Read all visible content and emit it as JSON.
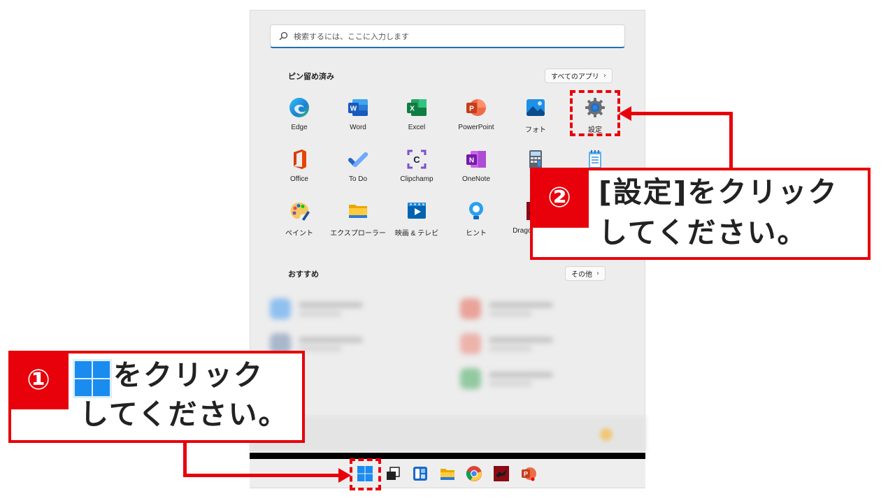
{
  "search": {
    "placeholder": "検索するには、ここに入力します"
  },
  "pinned": {
    "title": "ピン留め済み",
    "all_apps_label": "すべてのアプリ",
    "apps": [
      {
        "label": "Edge",
        "icon": "edge-icon"
      },
      {
        "label": "Word",
        "icon": "word-icon"
      },
      {
        "label": "Excel",
        "icon": "excel-icon"
      },
      {
        "label": "PowerPoint",
        "icon": "powerpoint-icon"
      },
      {
        "label": "フォト",
        "icon": "photos-icon"
      },
      {
        "label": "設定",
        "icon": "settings-gear-icon"
      },
      {
        "label": "Office",
        "icon": "office-icon"
      },
      {
        "label": "To Do",
        "icon": "todo-icon"
      },
      {
        "label": "Clipchamp",
        "icon": "clipchamp-icon"
      },
      {
        "label": "OneNote",
        "icon": "onenote-icon"
      },
      {
        "label": "",
        "icon": "calculator-icon"
      },
      {
        "label": "",
        "icon": "notepad-icon"
      },
      {
        "label": "ペイント",
        "icon": "paint-icon"
      },
      {
        "label": "エクスプローラー",
        "icon": "explorer-icon"
      },
      {
        "label": "映画 & テレビ",
        "icon": "movies-icon"
      },
      {
        "label": "ヒント",
        "icon": "tips-icon"
      },
      {
        "label": "Dragon Center",
        "icon": "dragon-center-icon"
      }
    ]
  },
  "recommended": {
    "title": "おすすめ",
    "more_label": "その他"
  },
  "taskbar": {
    "icons": [
      "windows-start-icon",
      "taskview-icon",
      "widgets-icon",
      "explorer-icon",
      "chrome-icon",
      "dragon-center-icon",
      "powerpoint-icon"
    ]
  },
  "callouts": {
    "step1": {
      "number": "①",
      "line1": "をクリック",
      "line2": "してください。"
    },
    "step2": {
      "number": "②",
      "line1": "[設定]をクリック",
      "line2": "してください。"
    }
  },
  "colors": {
    "annotation_red": "#e8000b",
    "accent_blue": "#1f6fb7"
  }
}
